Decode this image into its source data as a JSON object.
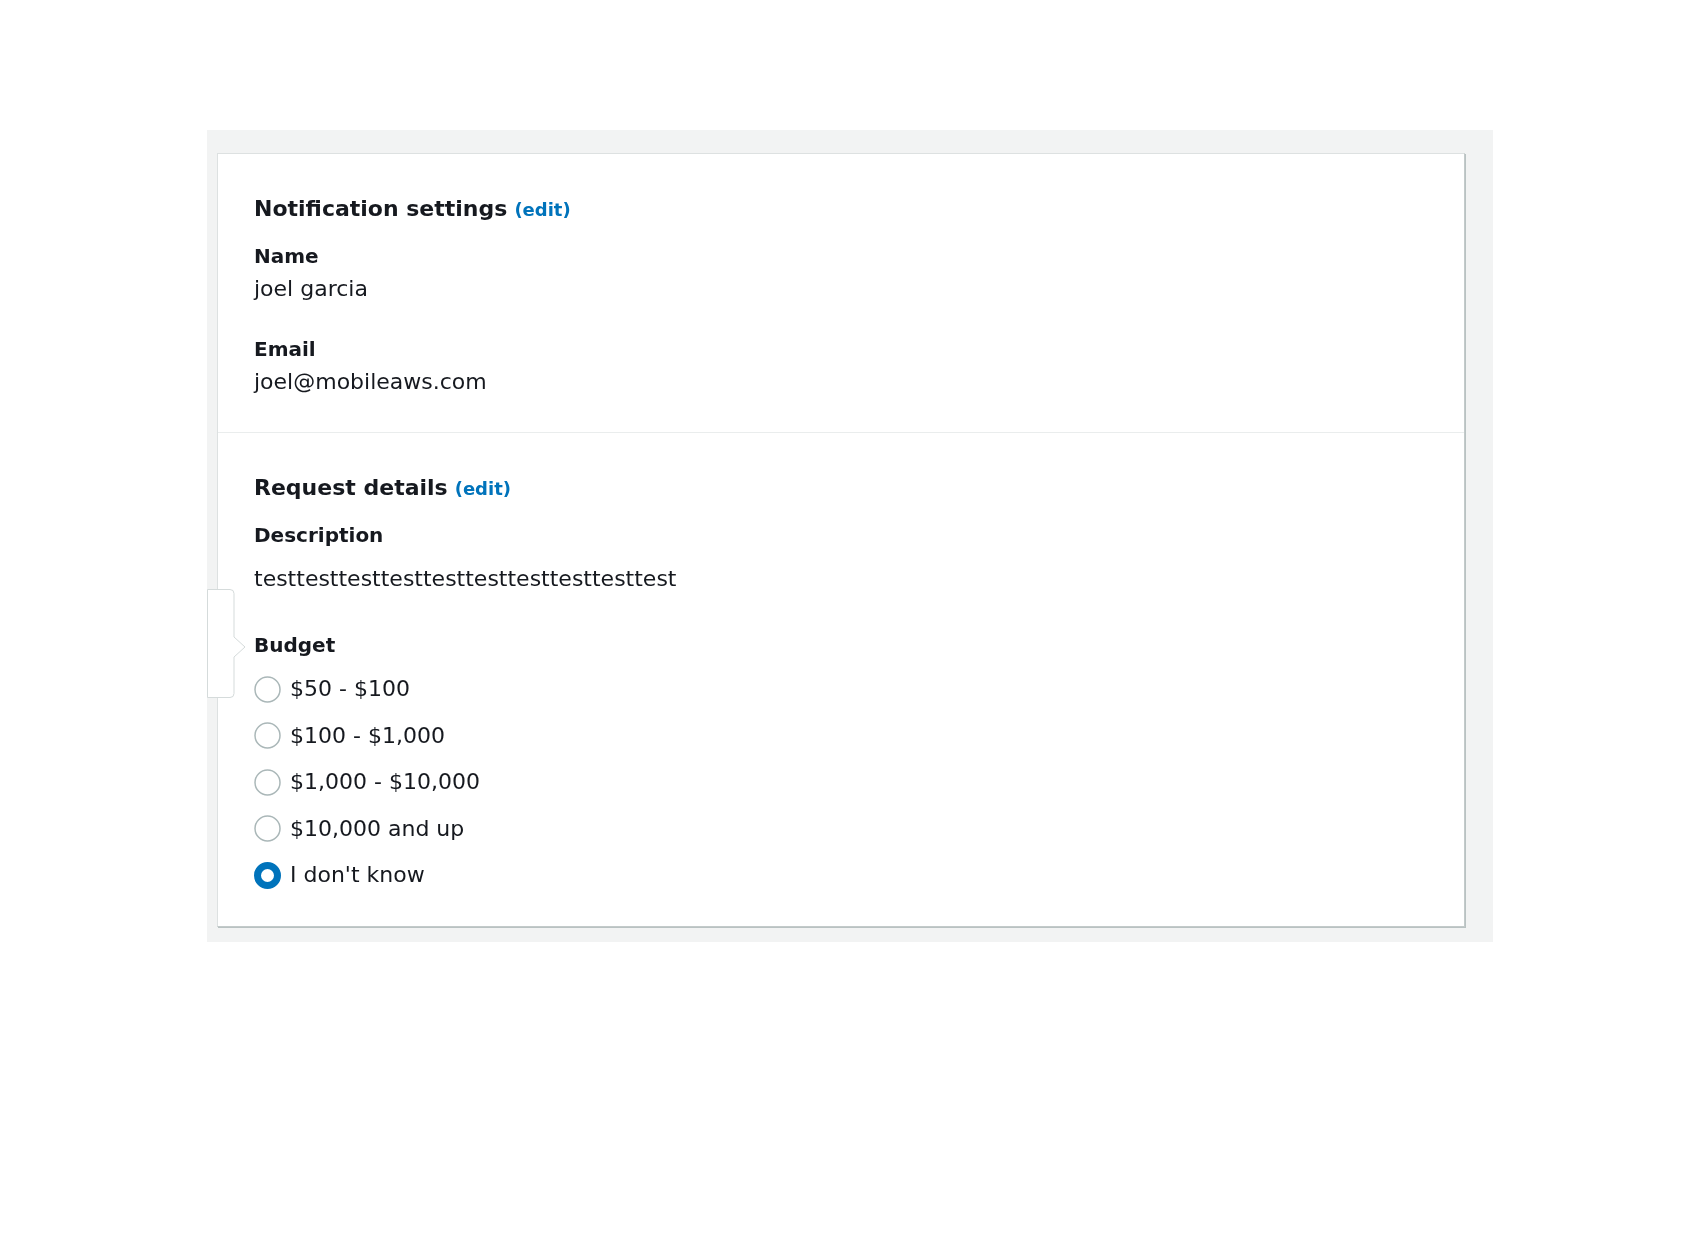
{
  "sections": [
    {
      "title": "Notification settings",
      "edit_link": "(edit)",
      "fields": [
        {
          "kind": "text",
          "label": "Name",
          "value": "joel garcia"
        },
        {
          "kind": "text",
          "label": "Email",
          "value": "joel@mobileaws.com"
        }
      ]
    },
    {
      "title": "Request details",
      "edit_link": "(edit)",
      "fields": [
        {
          "kind": "text",
          "label": "Description",
          "value": "testtesttesttesttesttesttesttesttesttest"
        },
        {
          "kind": "radio",
          "label": "Budget",
          "options": [
            {
              "label": "$50 - $100",
              "selected": false
            },
            {
              "label": "$100 - $1,000",
              "selected": false
            },
            {
              "label": "$1,000 - $10,000",
              "selected": false
            },
            {
              "label": "$10,000 and up",
              "selected": false
            },
            {
              "label": "I don't know",
              "selected": true
            }
          ]
        }
      ]
    }
  ]
}
